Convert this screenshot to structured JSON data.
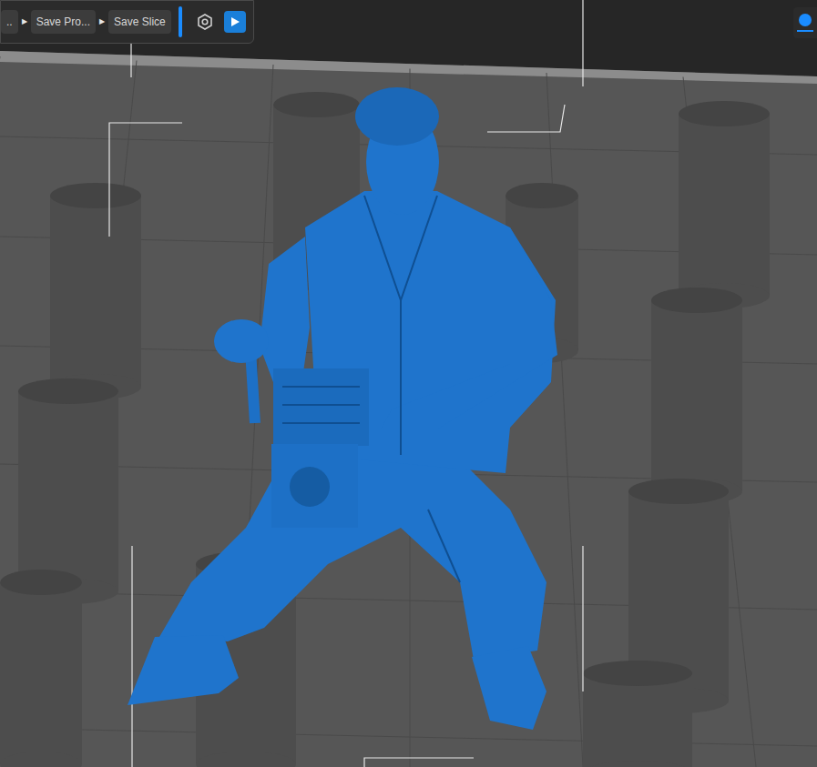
{
  "toolbar": {
    "items": [
      {
        "label": ".."
      },
      {
        "label": "Save Pro..."
      },
      {
        "label": "Save Slice"
      }
    ],
    "separator": "▶"
  },
  "view_toggle": {
    "selected": true
  }
}
